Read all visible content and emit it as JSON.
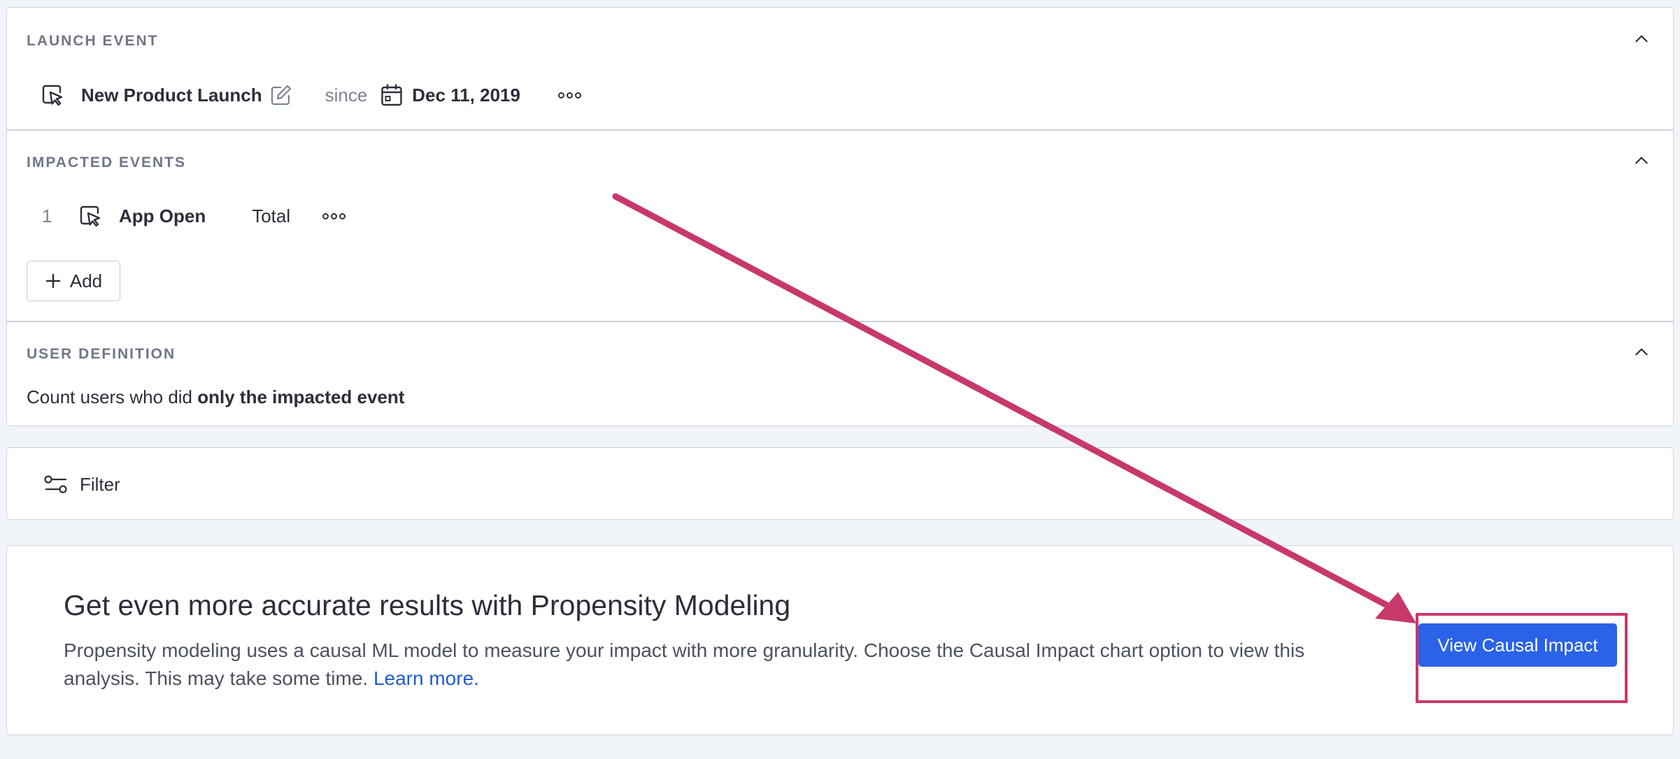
{
  "launch_event": {
    "section_title": "LAUNCH EVENT",
    "event_name": "New Product Launch",
    "since_label": "since",
    "date": "Dec 11, 2019"
  },
  "impacted_events": {
    "section_title": "IMPACTED EVENTS",
    "items": [
      {
        "index": "1",
        "name": "App Open",
        "measure": "Total"
      }
    ],
    "add_label": "Add"
  },
  "user_definition": {
    "section_title": "USER DEFINITION",
    "prefix": "Count users who did ",
    "emphasis": "only the impacted event"
  },
  "filter": {
    "label": "Filter"
  },
  "promo": {
    "title": "Get even more accurate results with Propensity Modeling",
    "body": "Propensity modeling uses a causal ML model to measure your impact with more granularity. Choose the Causal Impact chart option to view this analysis. This may take some time. ",
    "link_label": "Learn more.",
    "button_label": "View Causal Impact"
  },
  "annotation": {
    "color": "#c7386b"
  },
  "colors": {
    "accent": "#2a62e8",
    "link": "#1f5bd1",
    "background": "#f1f4f9"
  },
  "icons": {
    "event": "cursor-click-icon",
    "edit": "pencil-edit-icon",
    "calendar": "calendar-icon",
    "more": "more-options-icon",
    "collapse": "chevron-up-icon",
    "add": "plus-icon",
    "filter": "filter-sliders-icon"
  }
}
